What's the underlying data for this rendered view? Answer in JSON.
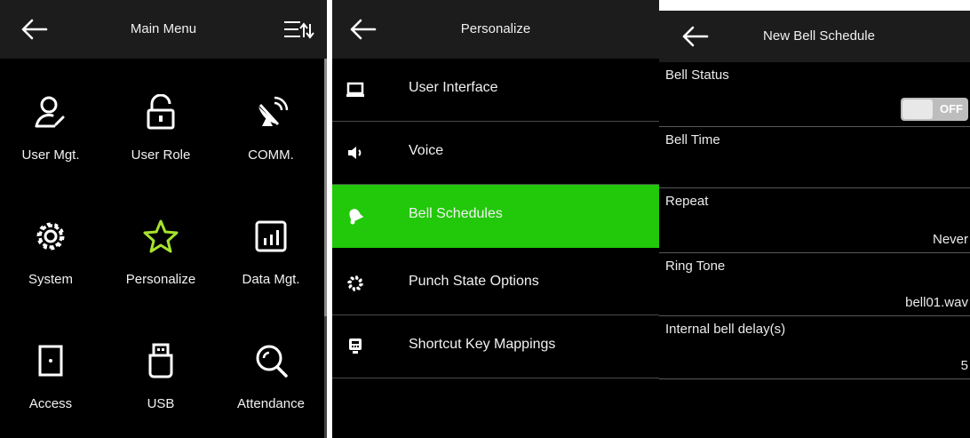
{
  "main_menu": {
    "title": "Main Menu",
    "items": [
      {
        "label": "User Mgt.",
        "icon": "user-mgt-icon"
      },
      {
        "label": "User Role",
        "icon": "lock-icon"
      },
      {
        "label": "COMM.",
        "icon": "satellite-dish-icon"
      },
      {
        "label": "System",
        "icon": "gear-icon"
      },
      {
        "label": "Personalize",
        "icon": "star-icon"
      },
      {
        "label": "Data Mgt.",
        "icon": "chart-icon"
      },
      {
        "label": "Access",
        "icon": "door-icon"
      },
      {
        "label": "USB",
        "icon": "usb-icon"
      },
      {
        "label": "Attendance",
        "icon": "magnifier-icon"
      }
    ],
    "accent_color": "#a6e22e"
  },
  "personalize": {
    "title": "Personalize",
    "items": [
      {
        "label": "User Interface",
        "icon": "monitor-icon"
      },
      {
        "label": "Voice",
        "icon": "speaker-icon"
      },
      {
        "label": "Bell Schedules",
        "icon": "bell-icon",
        "active": true
      },
      {
        "label": "Punch State Options",
        "icon": "gear-icon"
      },
      {
        "label": "Shortcut Key Mappings",
        "icon": "keypad-icon"
      }
    ],
    "active_color": "#22c80a"
  },
  "bell_schedule": {
    "title": "New Bell Schedule",
    "bell_status_label": "Bell Status",
    "bell_status_value": "OFF",
    "bell_time_label": "Bell Time",
    "repeat_label": "Repeat",
    "repeat_value": "Never",
    "ring_tone_label": "Ring Tone",
    "ring_tone_value": "bell01.wav",
    "delay_label": "Internal bell delay(s)",
    "delay_value": "5"
  }
}
